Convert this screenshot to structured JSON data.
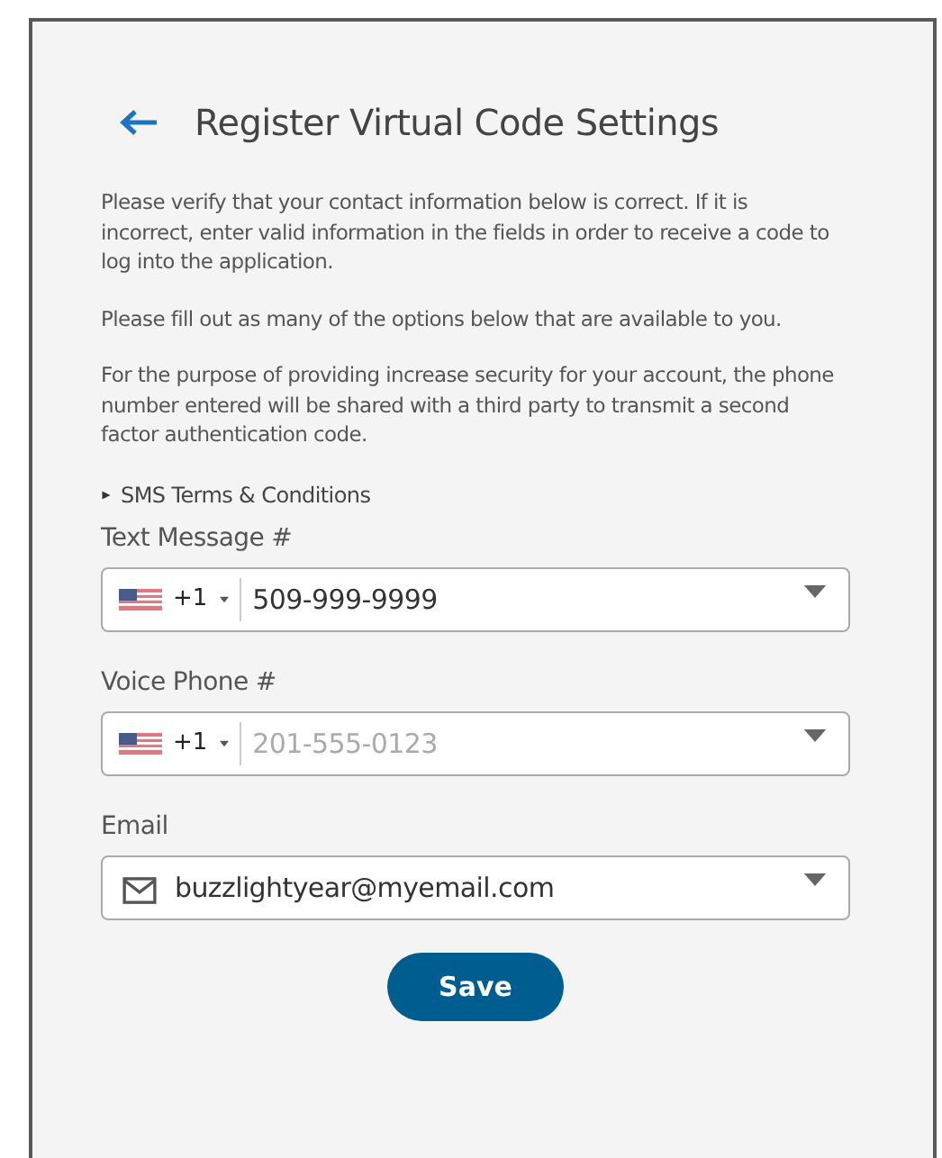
{
  "title": "Register Virtual Code Settings",
  "paragraphs": [
    "Please verify that your contact information below is correct. If it is incorrect, enter valid information in the fields in order to receive a code to log into the application.",
    "Please fill out as many of the options below that are available to you.",
    "For the purpose of providing increase security for your account, the phone number entered will be shared with a third party to transmit a second factor authentication code."
  ],
  "disclosure": {
    "label": "SMS Terms & Conditions",
    "expanded": false
  },
  "fields": [
    {
      "kind": "phone",
      "label": "Text Message #",
      "country_code": "+1",
      "value": "509-999-9999"
    },
    {
      "kind": "phone",
      "label": "Voice Phone #",
      "country_code": "+1",
      "placeholder": "201-555-0123"
    },
    {
      "kind": "email",
      "label": "Email",
      "value": "buzzlightyear@myemail.com"
    }
  ],
  "save_button": "Save"
}
